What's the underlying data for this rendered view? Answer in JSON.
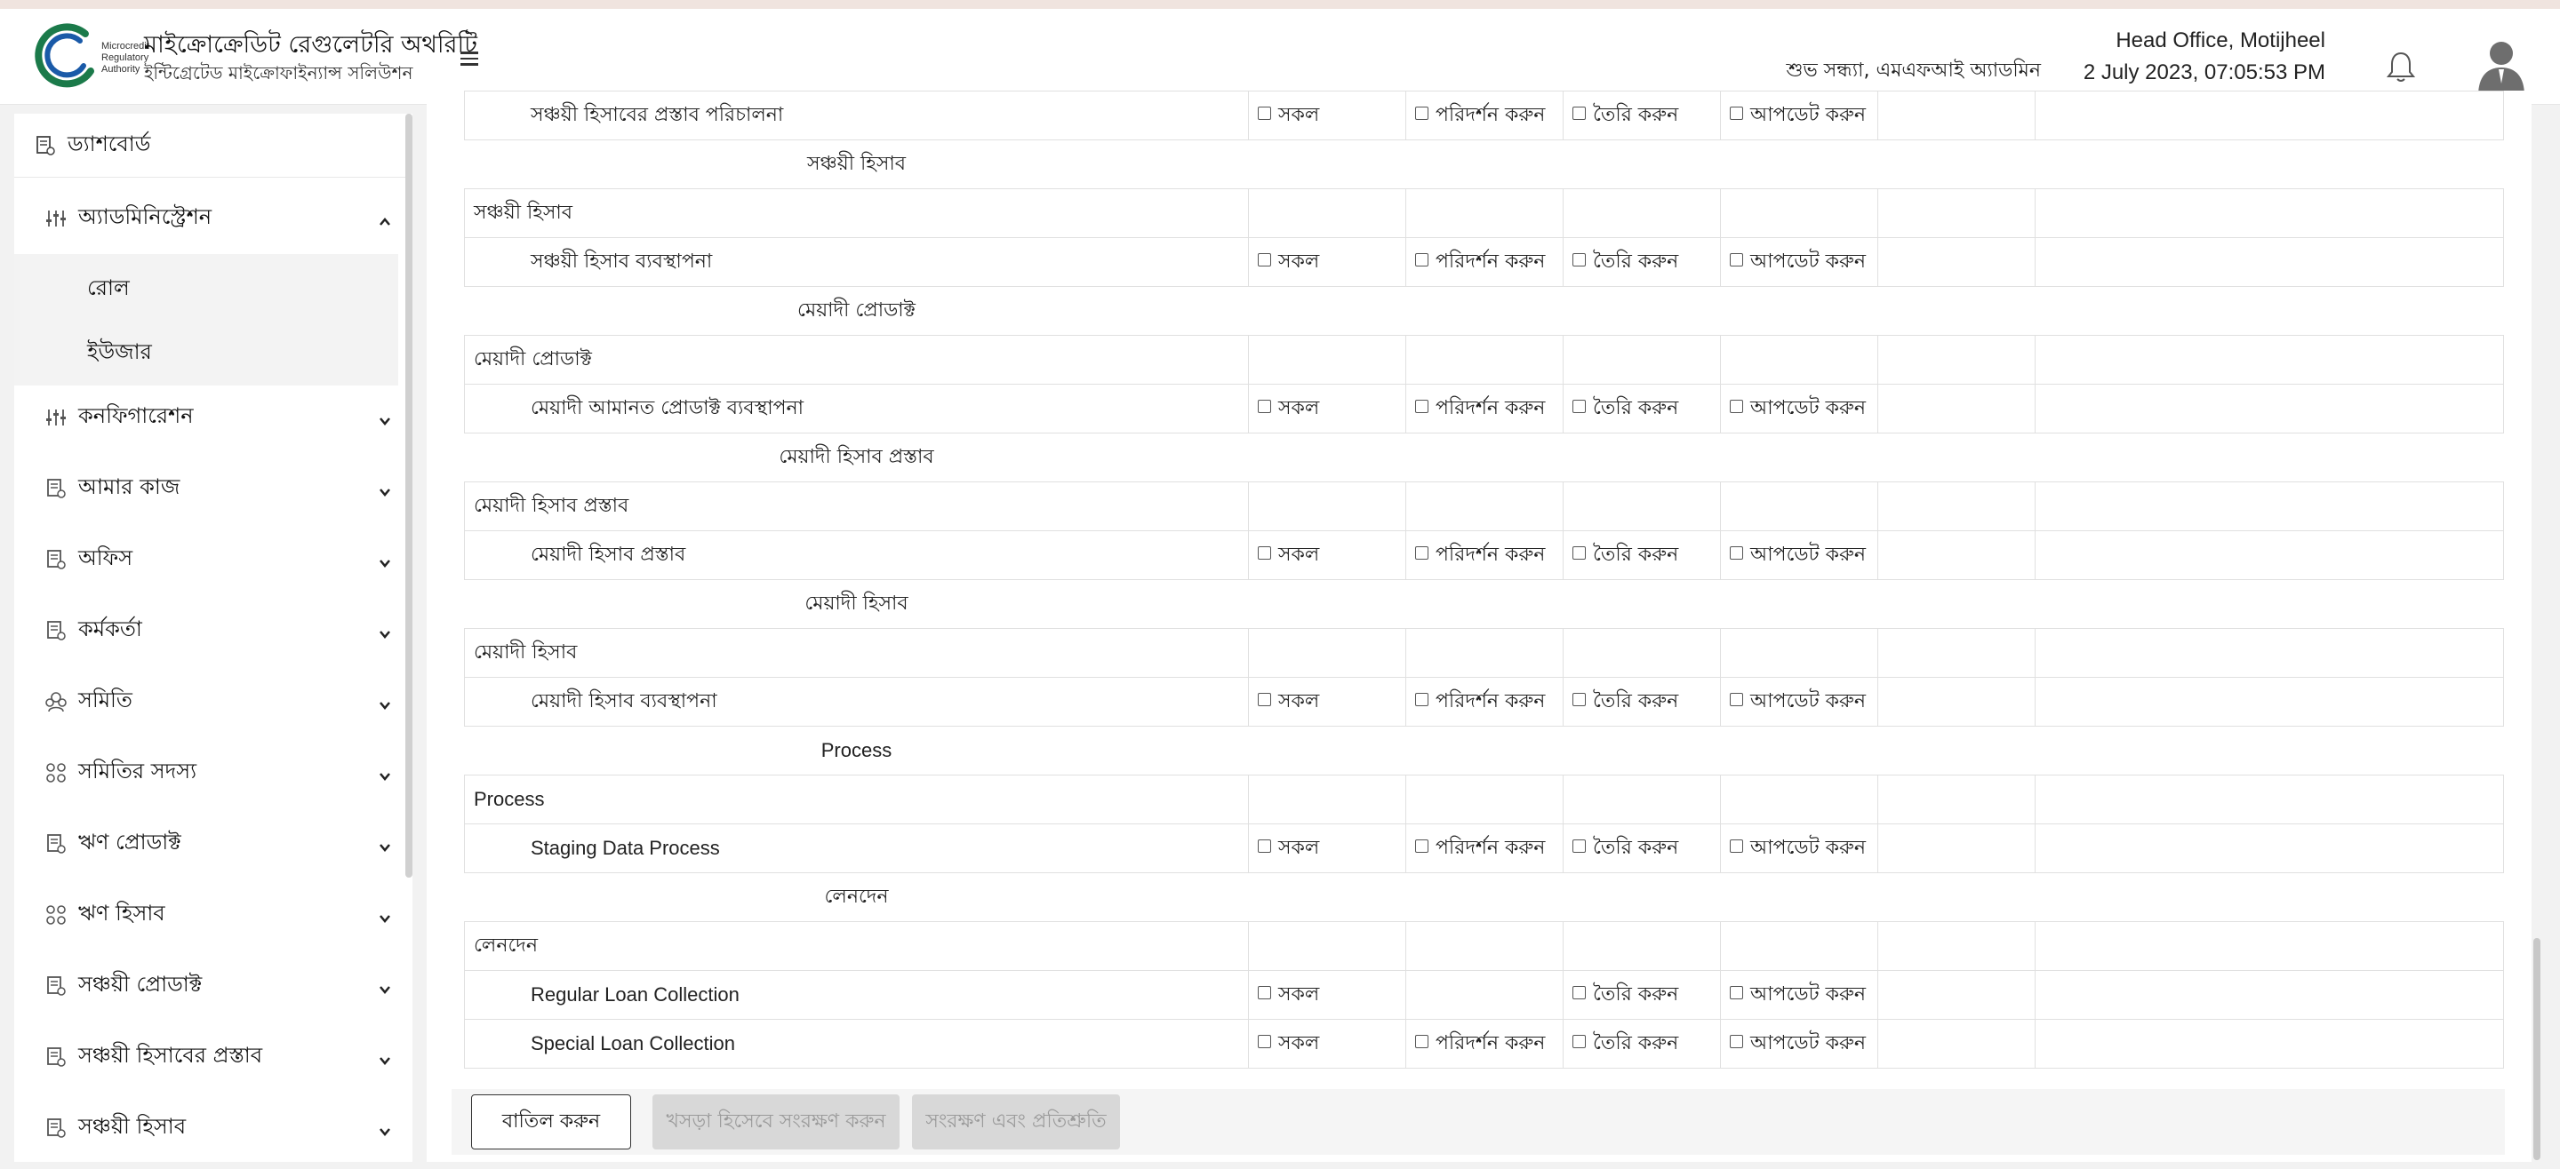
{
  "header": {
    "logo_text": [
      "Microcredit",
      "Regulatory",
      "Authority"
    ],
    "title": "মাইক্রোক্রেডিট রেগুলেটরি অথরিটি",
    "subtitle": "ইন্টিগ্রেটেড মাইক্রোফাইন্যান্স সলিউশন",
    "greeting": "শুভ সন্ধ্যা, এমএফআই অ্যাডমিন",
    "office": "Head Office, Motijheel",
    "datetime": "2 July 2023, 07:05:53 PM",
    "icons": [
      "menu-icon",
      "bell-icon",
      "user-avatar-icon"
    ]
  },
  "sidebar": {
    "dashboard": "ড্যাশবোর্ড",
    "items": [
      {
        "label": "অ্যাডমিনিস্ট্রেশন",
        "expanded": true
      },
      {
        "label": "কনফিগারেশন"
      },
      {
        "label": "আমার কাজ"
      },
      {
        "label": "অফিস"
      },
      {
        "label": "কর্মকর্তা"
      },
      {
        "label": "সমিতি"
      },
      {
        "label": "সমিতির সদস্য"
      },
      {
        "label": "ঋণ প্রোডাক্ট"
      },
      {
        "label": "ঋণ হিসাব"
      },
      {
        "label": "সঞ্চয়ী প্রোডাক্ট"
      },
      {
        "label": "সঞ্চয়ী হিসাবের প্রস্তাব"
      },
      {
        "label": "সঞ্চয়ী হিসাব"
      }
    ],
    "sub_items": [
      "রোল",
      "ইউজার"
    ]
  },
  "perm_labels": {
    "all": "সকল",
    "inspect": "পরিদর্শন করুন",
    "create": "তৈরি করুন",
    "update": "আপডেট করুন"
  },
  "rows": [
    {
      "type": "child",
      "label": "সঞ্চয়ী হিসাবের প্রস্তাব পরিচালনা",
      "perms": [
        "all",
        "inspect",
        "create",
        "update"
      ]
    },
    {
      "type": "section",
      "label": "সঞ্চয়ী হিসাব"
    },
    {
      "type": "group",
      "label": "সঞ্চয়ী হিসাব"
    },
    {
      "type": "child",
      "label": "সঞ্চয়ী হিসাব ব্যবস্থাপনা",
      "perms": [
        "all",
        "inspect",
        "create",
        "update"
      ]
    },
    {
      "type": "section",
      "label": "মেয়াদী প্রোডাক্ট"
    },
    {
      "type": "group",
      "label": "মেয়াদী প্রোডাক্ট"
    },
    {
      "type": "child",
      "label": "মেয়াদী আমানত প্রোডাক্ট ব্যবস্থাপনা",
      "perms": [
        "all",
        "inspect",
        "create",
        "update"
      ]
    },
    {
      "type": "section",
      "label": "মেয়াদী হিসাব প্রস্তাব"
    },
    {
      "type": "group",
      "label": "মেয়াদী হিসাব প্রস্তাব"
    },
    {
      "type": "child",
      "label": "মেয়াদী হিসাব প্রস্তাব",
      "perms": [
        "all",
        "inspect",
        "create",
        "update"
      ]
    },
    {
      "type": "section",
      "label": "মেয়াদী হিসাব"
    },
    {
      "type": "group",
      "label": "মেয়াদী হিসাব"
    },
    {
      "type": "child",
      "label": "মেয়াদী হিসাব ব্যবস্থাপনা",
      "perms": [
        "all",
        "inspect",
        "create",
        "update"
      ]
    },
    {
      "type": "section",
      "label": "Process"
    },
    {
      "type": "group",
      "label": "Process"
    },
    {
      "type": "child",
      "label": "Staging Data Process",
      "perms": [
        "all",
        "inspect",
        "create",
        "update"
      ]
    },
    {
      "type": "section",
      "label": "লেনদেন"
    },
    {
      "type": "group",
      "label": "লেনদেন"
    },
    {
      "type": "child",
      "label": "Regular Loan Collection",
      "perms": [
        "all",
        "",
        "create",
        "update"
      ]
    },
    {
      "type": "child",
      "label": "Special Loan Collection",
      "perms": [
        "all",
        "inspect",
        "create",
        "update"
      ]
    }
  ],
  "buttons": {
    "cancel": "বাতিল করুন",
    "draft": "খসড়া হিসেবে সংরক্ষণ করুন",
    "save": "সংরক্ষণ এবং প্রতিশ্রুতি"
  }
}
